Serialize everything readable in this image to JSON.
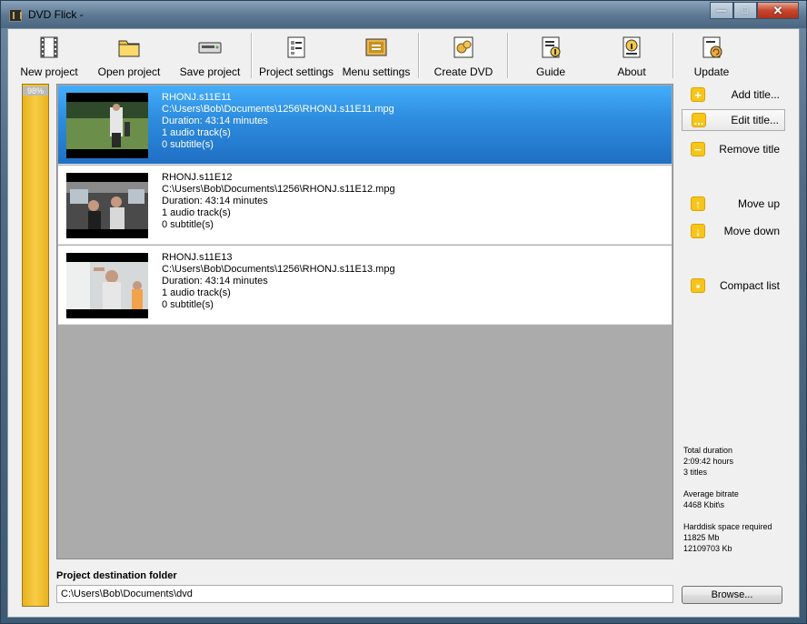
{
  "window": {
    "title": "DVD Flick -"
  },
  "caption_buttons": {
    "minimize": "—",
    "maximize": "□",
    "close": "✕"
  },
  "toolbar": [
    {
      "label": "New project",
      "icon": "new-project-icon"
    },
    {
      "label": "Open project",
      "icon": "folder-icon"
    },
    {
      "label": "Save project",
      "icon": "save-drive-icon"
    },
    {
      "label": "Project settings",
      "icon": "project-settings-icon"
    },
    {
      "label": "Menu settings",
      "icon": "menu-settings-icon"
    },
    {
      "label": "Create DVD",
      "icon": "create-dvd-icon"
    },
    {
      "label": "Guide",
      "icon": "guide-icon"
    },
    {
      "label": "About",
      "icon": "about-icon"
    },
    {
      "label": "Update",
      "icon": "update-icon"
    }
  ],
  "progress": {
    "label": "98%",
    "value": 0.98
  },
  "titles": [
    {
      "name": "RHONJ.s11E11",
      "path": "C:\\Users\\Bob\\Documents\\1256\\RHONJ.s11E11.mpg",
      "duration": "Duration: 43:14 minutes",
      "audio": "1 audio track(s)",
      "subtitles": "0 subtitle(s)",
      "selected": true
    },
    {
      "name": "RHONJ.s11E12",
      "path": "C:\\Users\\Bob\\Documents\\1256\\RHONJ.s11E12.mpg",
      "duration": "Duration: 43:14 minutes",
      "audio": "1 audio track(s)",
      "subtitles": "0 subtitle(s)",
      "selected": false
    },
    {
      "name": "RHONJ.s11E13",
      "path": "C:\\Users\\Bob\\Documents\\1256\\RHONJ.s11E13.mpg",
      "duration": "Duration: 43:14 minutes",
      "audio": "1 audio track(s)",
      "subtitles": "0 subtitle(s)",
      "selected": false
    }
  ],
  "side_buttons": [
    {
      "label": "Add title...",
      "icon": "plus-icon",
      "glyph": "+"
    },
    {
      "label": "Edit title...",
      "icon": "ellipsis-icon",
      "glyph": "..."
    },
    {
      "label": "Remove title",
      "icon": "minus-icon",
      "glyph": "−"
    },
    {
      "label": "Move up",
      "icon": "arrow-up-icon",
      "glyph": "↑"
    },
    {
      "label": "Move down",
      "icon": "arrow-down-icon",
      "glyph": "↓"
    },
    {
      "label": "Compact list",
      "icon": "compact-list-icon",
      "glyph": "▪"
    }
  ],
  "stats": {
    "total_duration_label": "Total duration",
    "total_duration": "2:09:42 hours",
    "titles_count": "3 titles",
    "bitrate_label": "Average bitrate",
    "bitrate": "4468 Kbit\\s",
    "space_label": "Harddisk space required",
    "space_mb": "11825 Mb",
    "space_kb": "12109703 Kb"
  },
  "destination": {
    "label": "Project destination folder",
    "value": "C:\\Users\\Bob\\Documents\\dvd",
    "browse_label": "Browse..."
  },
  "colors": {
    "accent_yellow": "#f7c51a",
    "selection_blue": "#2f8ee0",
    "list_background": "#ababab"
  }
}
